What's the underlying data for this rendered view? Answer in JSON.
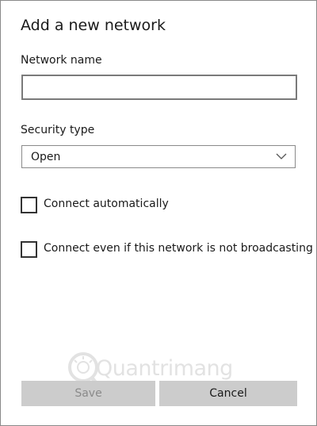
{
  "dialog": {
    "title": "Add a new network"
  },
  "network_name": {
    "label": "Network name",
    "value": "",
    "placeholder": ""
  },
  "security_type": {
    "label": "Security type",
    "selected": "Open",
    "icon": "chevron-down-icon"
  },
  "options": {
    "connect_automatically": {
      "label": "Connect automatically",
      "checked": false
    },
    "connect_not_broadcasting": {
      "label": "Connect even if this network is not broadcasting",
      "checked": false
    }
  },
  "buttons": {
    "save_label": "Save",
    "save_enabled": false,
    "cancel_label": "Cancel"
  },
  "watermark": {
    "text": "Quantrimang"
  }
}
